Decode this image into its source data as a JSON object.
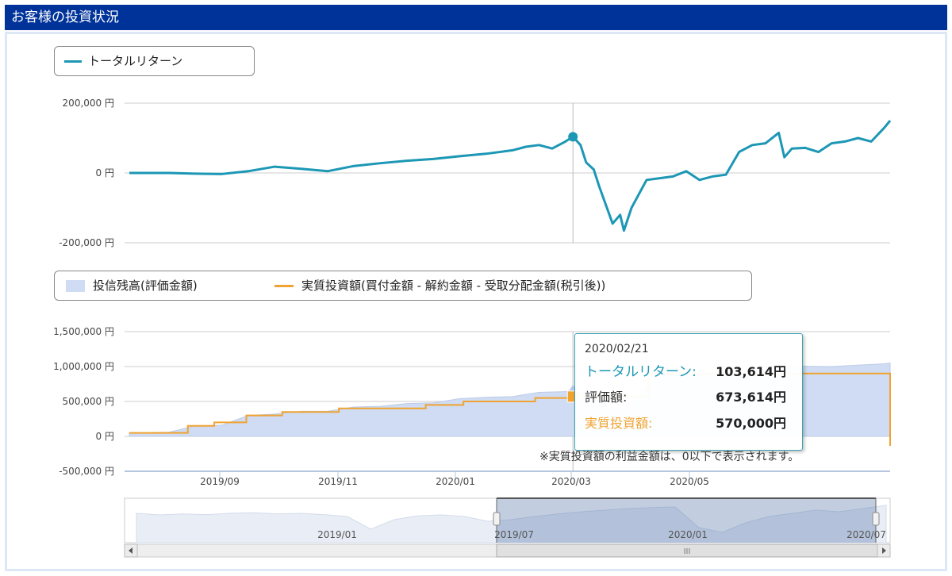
{
  "header": {
    "title": "お客様の投資状況"
  },
  "legend_top": {
    "label": "トータルリターン"
  },
  "legend_bottom": {
    "balance_label": "投信残高(評価金額)",
    "invest_label": "実質投資額(買付金額 - 解約金額 - 受取分配金額(税引後))"
  },
  "tooltip": {
    "date": "2020/02/21",
    "return_label": "トータルリターン:",
    "return_value": "103,614円",
    "eval_label": "評価額:",
    "eval_value": "673,614円",
    "invest_label": "実質投資額:",
    "invest_value": "570,000円"
  },
  "note": "※実質投資額の利益金額は、0以下で表示されます。",
  "colors": {
    "header": "#003399",
    "return_line": "#1c97b5",
    "balance_area": "#cfdcf3",
    "invest_line": "#f0a330",
    "navigator": "#8fa5c9"
  },
  "chart_data": [
    {
      "type": "line",
      "series": [
        {
          "name": "トータルリターン",
          "x": [
            "2019/07/01",
            "2019/07/22",
            "2019/08/05",
            "2019/08/19",
            "2019/09/02",
            "2019/09/16",
            "2019/09/30",
            "2019/10/14",
            "2019/10/28",
            "2019/11/11",
            "2019/11/25",
            "2019/12/09",
            "2019/12/23",
            "2020/01/06",
            "2020/01/20",
            "2020/01/27",
            "2020/02/03",
            "2020/02/10",
            "2020/02/17",
            "2020/02/21",
            "2020/02/25",
            "2020/02/28",
            "2020/03/03",
            "2020/03/06",
            "2020/03/10",
            "2020/03/13",
            "2020/03/17",
            "2020/03/19",
            "2020/03/23",
            "2020/03/27",
            "2020/03/31",
            "2020/04/07",
            "2020/04/14",
            "2020/04/21",
            "2020/04/28",
            "2020/05/05",
            "2020/05/12",
            "2020/05/19",
            "2020/05/26",
            "2020/06/02",
            "2020/06/09",
            "2020/06/12",
            "2020/06/16",
            "2020/06/23",
            "2020/06/30",
            "2020/07/07",
            "2020/07/14",
            "2020/07/21",
            "2020/07/28",
            "2020/08/04",
            "2020/08/07"
          ],
          "values": [
            0,
            0,
            -2000,
            -3000,
            5000,
            18000,
            12000,
            5000,
            20000,
            28000,
            35000,
            40000,
            48000,
            55000,
            65000,
            75000,
            80000,
            70000,
            90000,
            103614,
            80000,
            30000,
            10000,
            -40000,
            -100000,
            -145000,
            -120000,
            -165000,
            -100000,
            -60000,
            -20000,
            -15000,
            -10000,
            5000,
            -20000,
            -10000,
            -5000,
            60000,
            80000,
            85000,
            115000,
            45000,
            70000,
            72000,
            60000,
            85000,
            90000,
            100000,
            90000,
            130000,
            150000
          ]
        }
      ],
      "xticks": [
        "2019/09",
        "2019/11",
        "2020/01",
        "2020/03",
        "2020/05"
      ],
      "yticks": [
        "200,000 円",
        "0 円",
        "-200,000 円"
      ],
      "ylim": [
        -200000,
        200000
      ]
    },
    {
      "type": "area",
      "series": [
        {
          "name": "投信残高(評価金額)",
          "x": [
            "2019/07/01",
            "2019/07/22",
            "2019/08/05",
            "2019/08/19",
            "2019/09/02",
            "2019/09/16",
            "2019/09/30",
            "2019/10/14",
            "2019/10/28",
            "2019/11/11",
            "2019/11/25",
            "2019/12/09",
            "2019/12/23",
            "2020/01/06",
            "2020/01/20",
            "2020/02/03",
            "2020/02/17",
            "2020/02/21",
            "2020/03/03",
            "2020/03/13",
            "2020/03/19",
            "2020/04/07",
            "2020/05/05",
            "2020/06/02",
            "2020/06/09",
            "2020/07/07",
            "2020/08/04",
            "2020/08/07"
          ],
          "values": [
            50000,
            60000,
            150000,
            160000,
            300000,
            320000,
            360000,
            360000,
            420000,
            430000,
            470000,
            480000,
            540000,
            560000,
            570000,
            630000,
            640000,
            673614,
            560000,
            410000,
            380000,
            880000,
            900000,
            980000,
            1010000,
            1000000,
            1040000,
            1050000
          ]
        },
        {
          "name": "実質投資額(買付金額 - 解約金額 - 受取分配金額(税引後))",
          "x": [
            "2019/07/01",
            "2019/08/01",
            "2019/08/15",
            "2019/09/01",
            "2019/09/20",
            "2019/10/20",
            "2019/11/10",
            "2019/12/05",
            "2019/12/25",
            "2020/02/01",
            "2020/02/21",
            "2020/03/05",
            "2020/04/01",
            "2020/05/01",
            "2020/06/01",
            "2020/08/07"
          ],
          "values": [
            50000,
            150000,
            200000,
            300000,
            350000,
            400000,
            400000,
            450000,
            500000,
            550000,
            570000,
            570000,
            900000,
            900000,
            900000,
            900000
          ]
        }
      ],
      "xticks": [
        "2019/09",
        "2019/11",
        "2020/01",
        "2020/03",
        "2020/05"
      ],
      "yticks": [
        "1,500,000 円",
        "1,000,000 円",
        "500,000 円",
        "0 円",
        "-500,000 円"
      ],
      "ylim": [
        -500000,
        1500000
      ]
    }
  ],
  "navigator": {
    "labels": [
      "2019/01",
      "2019/07",
      "2020/01",
      "2020/07"
    ],
    "scroll_grip": "III"
  }
}
